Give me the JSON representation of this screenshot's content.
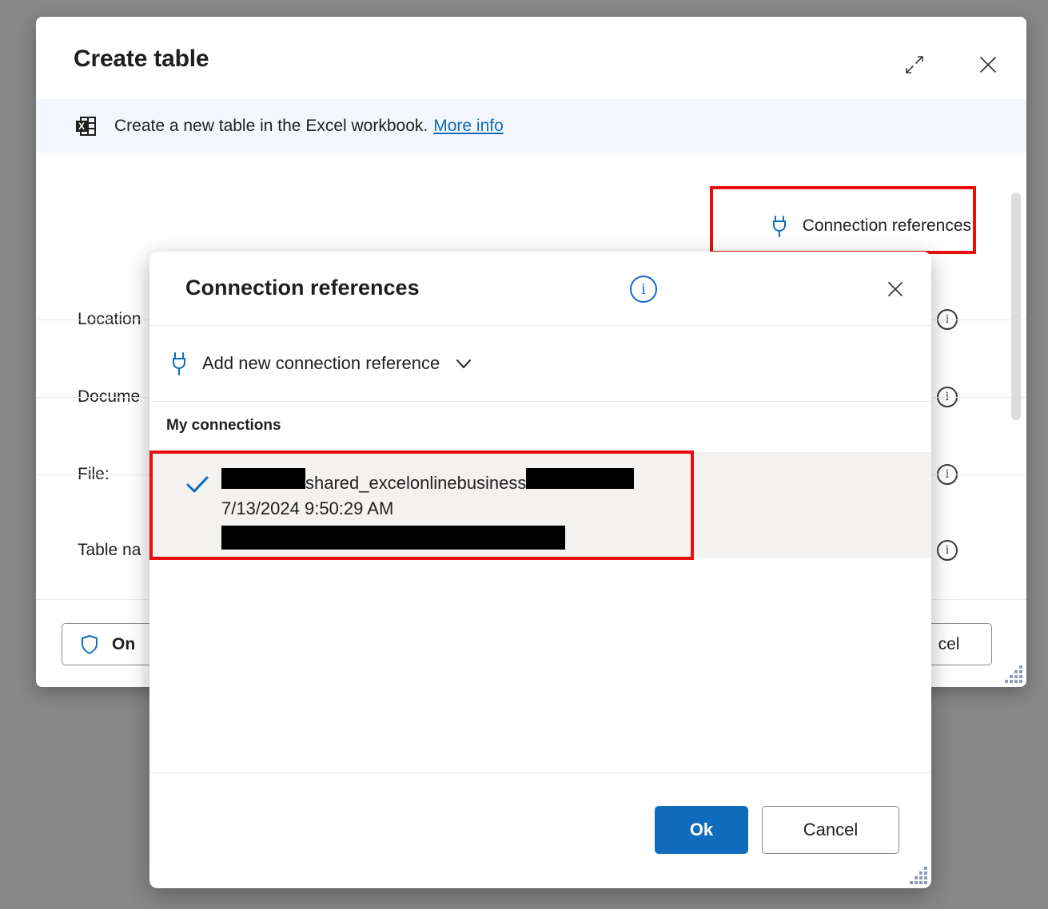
{
  "create_table": {
    "title": "Create table",
    "expand_icon": "expand-diagonal-icon",
    "close_icon": "close-icon",
    "banner": {
      "icon": "excel-file-icon",
      "text": "Create a new table in the Excel workbook.",
      "link_label": "More info"
    },
    "connection_references_button": {
      "icon": "plug-icon",
      "label": "Connection references"
    },
    "fields": [
      {
        "label": "Location",
        "info_icon": "info-circle-icon"
      },
      {
        "label": "Docume",
        "info_icon": "info-circle-icon"
      },
      {
        "label": "File:",
        "info_icon": "info-circle-icon"
      },
      {
        "label": "Table na",
        "info_icon": "info-circle-icon"
      }
    ],
    "footer": {
      "online_button": {
        "icon": "shield-icon",
        "label": "On"
      },
      "cancel_button_label": "cel"
    }
  },
  "connection_references": {
    "title": "Connection references",
    "title_info_icon": "info-circle-icon",
    "close_icon": "close-icon",
    "add_new": {
      "icon": "plug-icon",
      "label": "Add new connection reference",
      "chevron_icon": "chevron-down-icon"
    },
    "section_label": "My connections",
    "selected_connection": {
      "check_icon": "checkmark-icon",
      "name_prefix_redacted": true,
      "name_visible": "shared_excelonlinebusiness",
      "name_suffix_redacted": true,
      "timestamp": "7/13/2024 9:50:29 AM",
      "owner_redacted": true
    },
    "buttons": {
      "ok_label": "Ok",
      "cancel_label": "Cancel"
    }
  },
  "colors": {
    "accent_blue": "#0f6cbd",
    "highlight_red": "#e8100f",
    "banner_background": "#f3f7fd",
    "selected_row_background": "#f3f2f1",
    "page_background": "#878787"
  }
}
